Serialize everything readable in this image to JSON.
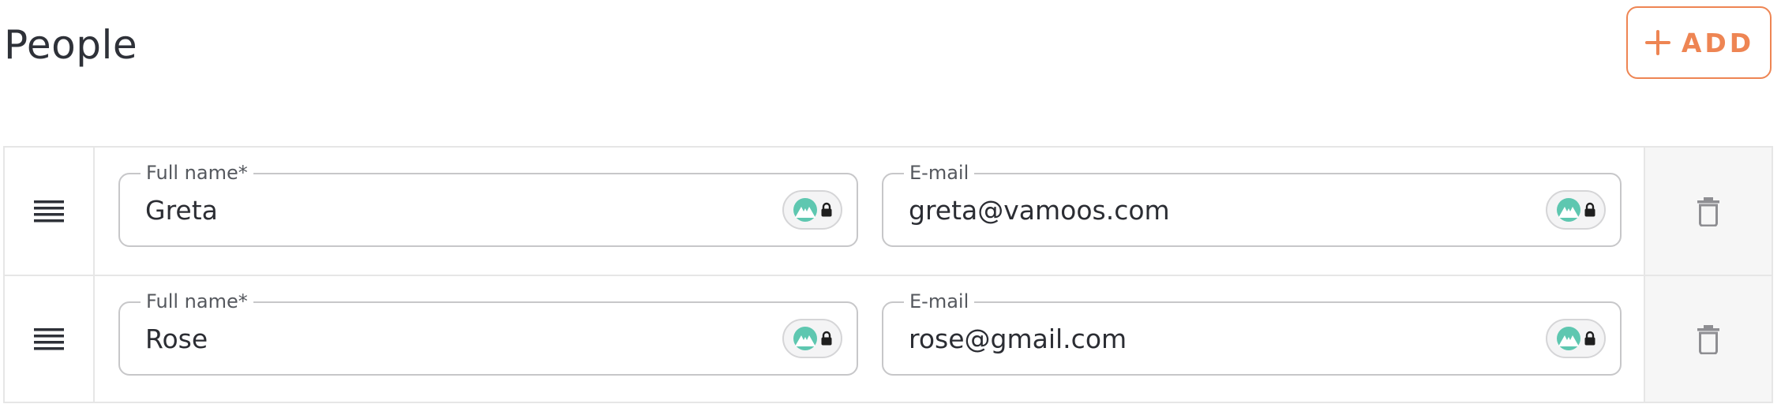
{
  "header": {
    "title": "People",
    "add_button_label": "ADD"
  },
  "colors": {
    "accent": "#ee8553",
    "badge_teal": "#5ec7b0",
    "border": "#c7c7c9",
    "text": "#2b2d33"
  },
  "icons": {
    "add": "plus-icon",
    "drag": "drag-handle-icon",
    "password_manager": "nordpass-logo-icon",
    "lock": "lock-icon",
    "delete": "trash-icon"
  },
  "people": [
    {
      "full_name_label": "Full name*",
      "full_name_value": "Greta",
      "email_label": "E-mail",
      "email_value": "greta@vamoos.com"
    },
    {
      "full_name_label": "Full name*",
      "full_name_value": "Rose",
      "email_label": "E-mail",
      "email_value": "rose@gmail.com"
    }
  ]
}
